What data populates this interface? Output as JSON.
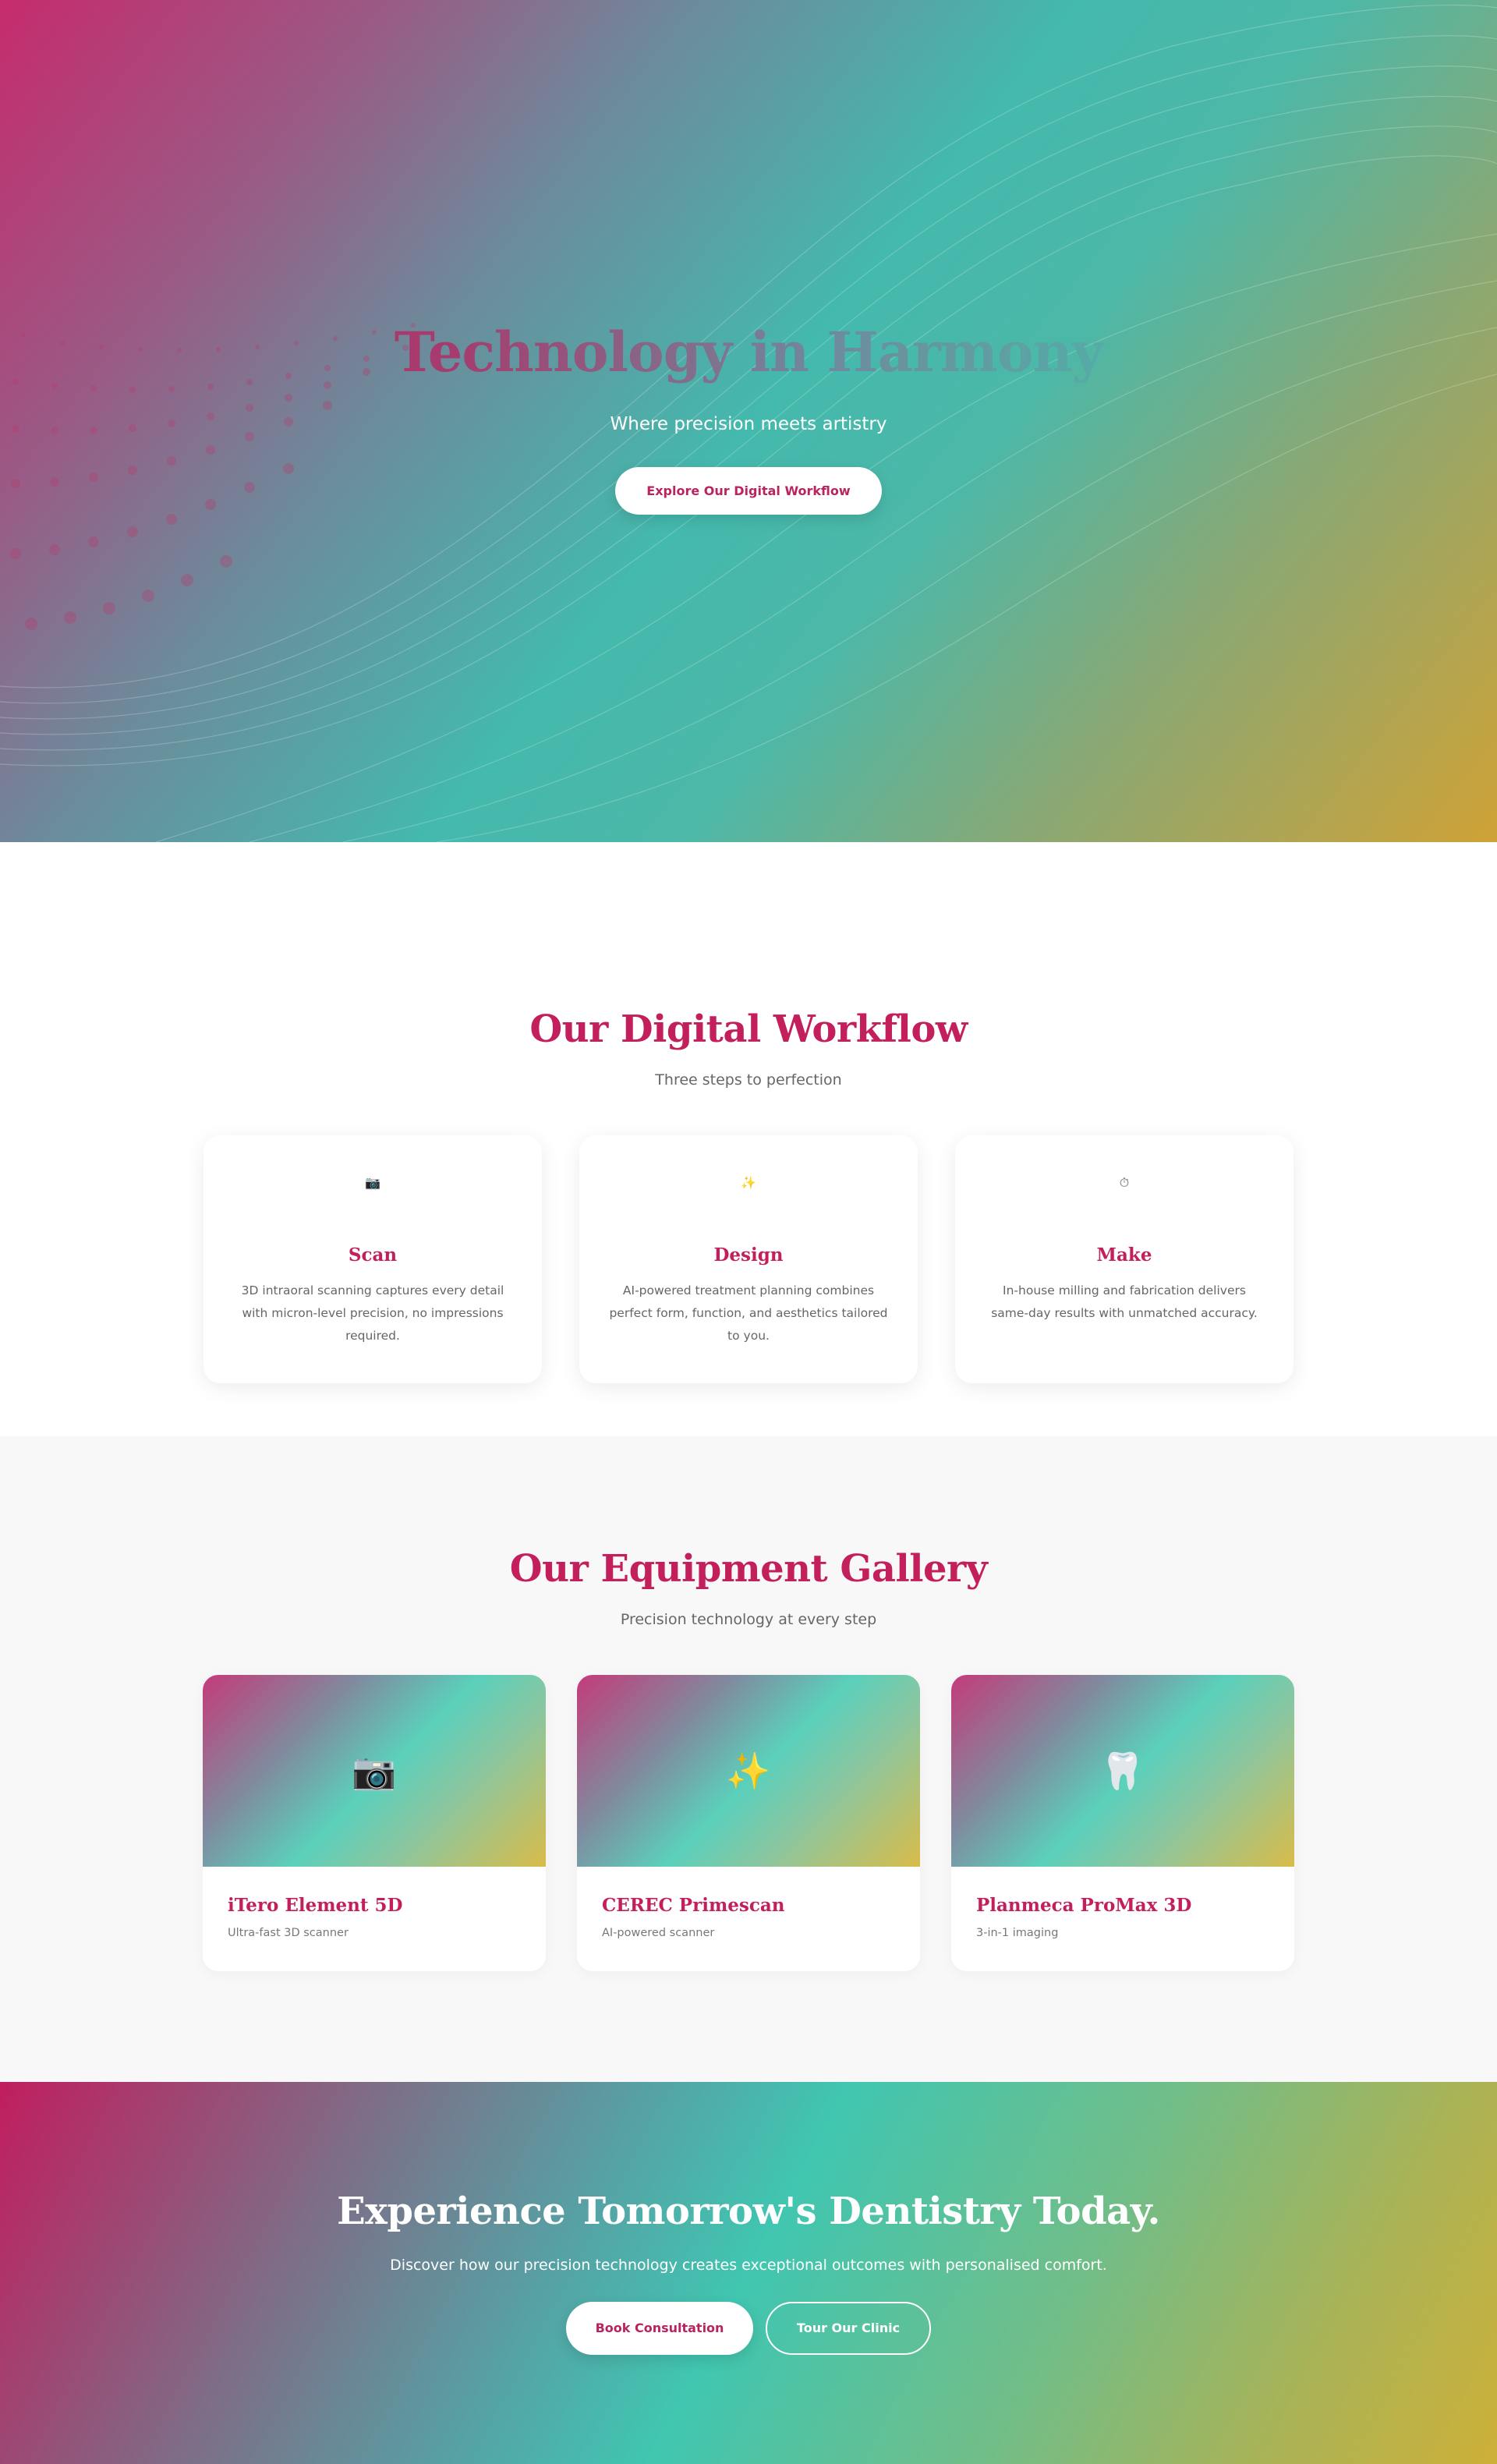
{
  "hero": {
    "title": "Technology in Harmony",
    "subtitle": "Where precision meets artistry",
    "button_label": "Explore Our Digital Workflow"
  },
  "workflow": {
    "title": "Our Digital Workflow",
    "subtitle": "Three steps to perfection",
    "cards": [
      {
        "icon": "camera-icon",
        "glyph": "📷",
        "title": "Scan",
        "text": "3D intraoral scanning captures every detail with micron-level precision, no impressions required."
      },
      {
        "icon": "sparkles-icon",
        "glyph": "✨",
        "title": "Design",
        "text": "AI-powered treatment planning combines perfect form, function, and aesthetics tailored to you."
      },
      {
        "icon": "stopwatch-icon",
        "glyph": "⏱",
        "title": "Make",
        "text": "In-house milling and fabrication delivers same-day results with unmatched accuracy."
      }
    ]
  },
  "gallery": {
    "title": "Our Equipment Gallery",
    "subtitle": "Precision technology at every step",
    "items": [
      {
        "icon": "camera-icon",
        "glyph": "📷",
        "title": "iTero Element 5D",
        "subtitle": "Ultra-fast 3D scanner"
      },
      {
        "icon": "sparkles-icon",
        "glyph": "✨",
        "title": "CEREC Primescan",
        "subtitle": "AI-powered scanner"
      },
      {
        "icon": "tooth-icon",
        "glyph": "🦷",
        "title": "Planmeca ProMax 3D",
        "subtitle": "3-in-1 imaging"
      }
    ]
  },
  "cta": {
    "title": "Experience Tomorrow's Dentistry Today.",
    "subtitle": "Discover how our precision technology creates exceptional outcomes with personalised comfort.",
    "primary_label": "Book Consultation",
    "secondary_label": "Tour Our Clinic"
  },
  "colors": {
    "brand": "#c21f5c",
    "teal": "#44b9ad",
    "gold": "#cfa236"
  }
}
